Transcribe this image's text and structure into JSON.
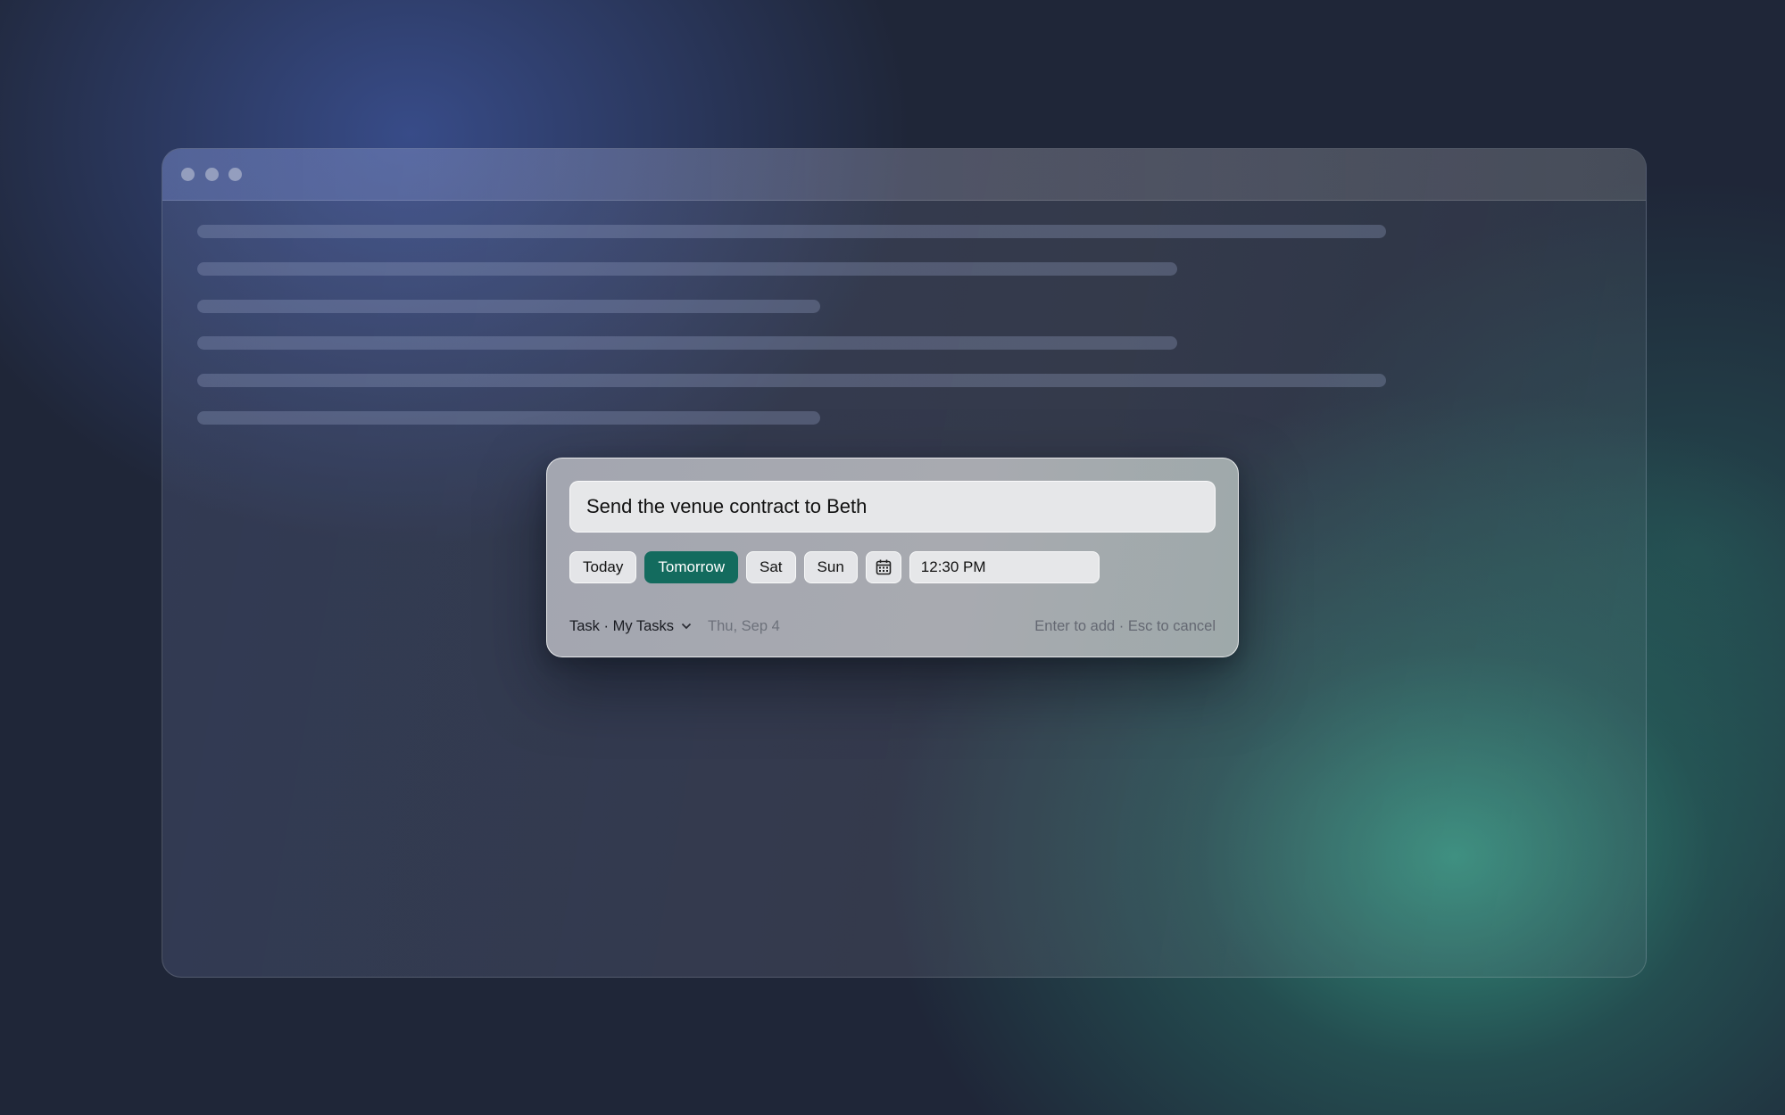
{
  "window": {
    "buttons": [
      "close",
      "minimize",
      "zoom"
    ]
  },
  "quick_add": {
    "task_title": "Send the venue contract to Beth",
    "date_options": [
      {
        "label": "Today",
        "selected": false
      },
      {
        "label": "Tomorrow",
        "selected": true
      },
      {
        "label": "Sat",
        "selected": false
      },
      {
        "label": "Sun",
        "selected": false
      }
    ],
    "calendar_icon": "calendar-icon",
    "time_value": "12:30 PM",
    "list_selector": "Task · My Tasks",
    "dropdown_icon": "chevron-down-icon",
    "due_date": "Thu, Sep 4",
    "hint": "Enter to add · Esc to cancel"
  },
  "colors": {
    "accent": "#136b5e",
    "background": "#1f2638",
    "teal_glow": "#349680"
  }
}
